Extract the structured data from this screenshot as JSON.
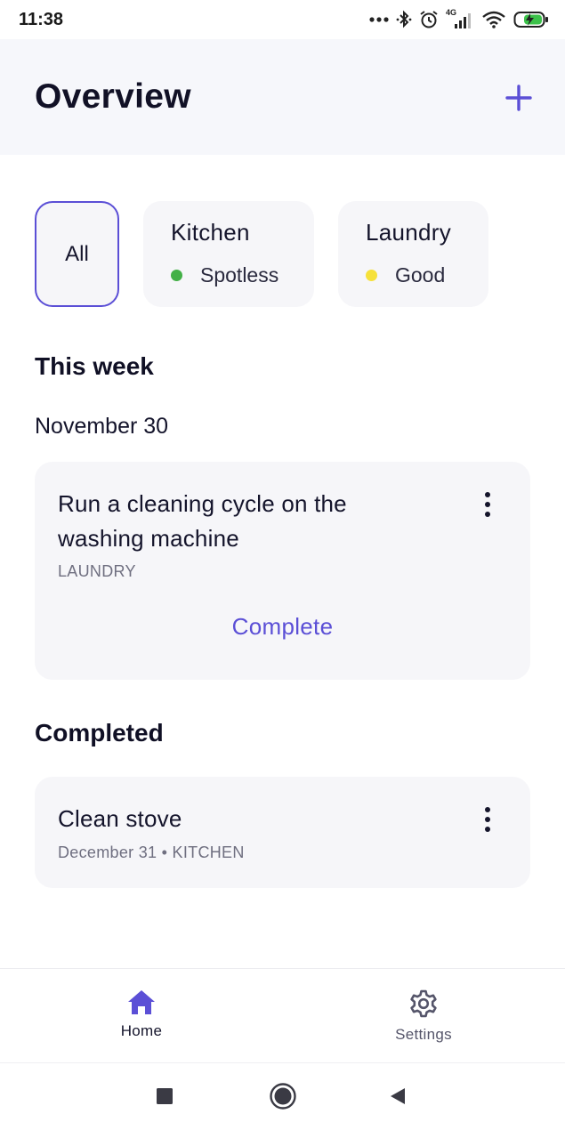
{
  "status_bar": {
    "time": "11:38",
    "icons": [
      "more-dots-icon",
      "bluetooth-icon",
      "alarm-icon",
      "signal-4g-icon",
      "wifi-icon",
      "battery-charging-icon"
    ],
    "network_label": "4G"
  },
  "header": {
    "title": "Overview",
    "add_icon": "plus-icon"
  },
  "filters": {
    "all_label": "All",
    "rooms": [
      {
        "name": "Kitchen",
        "status": "Spotless",
        "status_color": "#43b047"
      },
      {
        "name": "Laundry",
        "status": "Good",
        "status_color": "#f6e13a"
      }
    ]
  },
  "this_week": {
    "title": "This week",
    "date": "November 30",
    "task": {
      "title": "Run a cleaning cycle on the washing machine",
      "room": "LAUNDRY",
      "action_label": "Complete"
    }
  },
  "completed": {
    "title": "Completed",
    "task": {
      "title": "Clean stove",
      "meta": "December 31 • KITCHEN"
    }
  },
  "bottom_nav": {
    "items": [
      {
        "label": "Home",
        "icon": "home-icon",
        "active": true
      },
      {
        "label": "Settings",
        "icon": "gear-icon",
        "active": false
      }
    ]
  },
  "colors": {
    "accent": "#5b4fd6",
    "card_bg": "#f6f6f9",
    "header_bg": "#f6f7fb"
  }
}
